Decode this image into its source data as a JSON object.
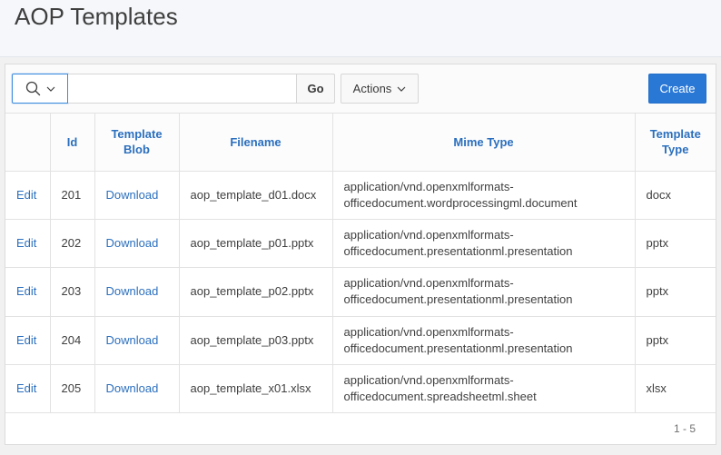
{
  "page": {
    "title": "AOP Templates"
  },
  "toolbar": {
    "search": {
      "value": ""
    },
    "go_label": "Go",
    "actions_label": "Actions",
    "create_label": "Create"
  },
  "icons": {
    "search_column_button": [
      "search-icon",
      "chevron-down-icon"
    ],
    "actions_button": "chevron-down-icon"
  },
  "colors": {
    "title_bar": "#f5f7fa",
    "link": "#2b6fbe",
    "primary_button": "#2a78d6",
    "focus_border": "#3d8be0"
  },
  "report": {
    "columns": [
      "Id",
      "Template Blob",
      "Filename",
      "Mime Type",
      "Template Type"
    ],
    "rows": [
      {
        "edit": "Edit",
        "id": 201,
        "template_blob": "Download",
        "filename": "aop_template_d01.docx",
        "mime_type": "application/vnd.openxmlformats-officedocument.wordprocessingml.document",
        "template_type": "docx"
      },
      {
        "edit": "Edit",
        "id": 202,
        "template_blob": "Download",
        "filename": "aop_template_p01.pptx",
        "mime_type": "application/vnd.openxmlformats-officedocument.presentationml.presentation",
        "template_type": "pptx"
      },
      {
        "edit": "Edit",
        "id": 203,
        "template_blob": "Download",
        "filename": "aop_template_p02.pptx",
        "mime_type": "application/vnd.openxmlformats-officedocument.presentationml.presentation",
        "template_type": "pptx"
      },
      {
        "edit": "Edit",
        "id": 204,
        "template_blob": "Download",
        "filename": "aop_template_p03.pptx",
        "mime_type": "application/vnd.openxmlformats-officedocument.presentationml.presentation",
        "template_type": "pptx"
      },
      {
        "edit": "Edit",
        "id": 205,
        "template_blob": "Download",
        "filename": "aop_template_x01.xlsx",
        "mime_type": "application/vnd.openxmlformats-officedocument.spreadsheetml.sheet",
        "template_type": "xlsx"
      }
    ],
    "pagination": "1 - 5"
  }
}
